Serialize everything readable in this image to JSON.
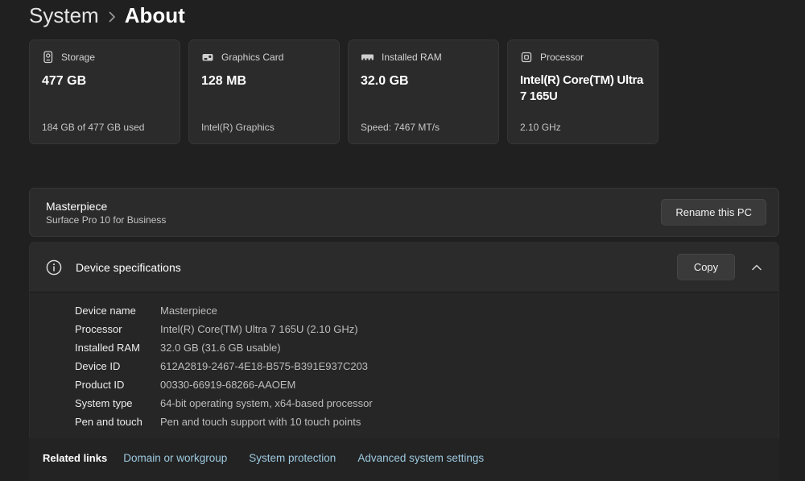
{
  "breadcrumb": {
    "root": "System",
    "current": "About",
    "separator_icon": "chevron-right-icon"
  },
  "cards": [
    {
      "icon": "storage-icon",
      "label": "Storage",
      "value": "477 GB",
      "caption": "184 GB of 477 GB used"
    },
    {
      "icon": "gpu-icon",
      "label": "Graphics Card",
      "value": "128 MB",
      "caption": "Intel(R) Graphics"
    },
    {
      "icon": "ram-icon",
      "label": "Installed RAM",
      "value": "32.0 GB",
      "caption": "Speed: 7467 MT/s"
    },
    {
      "icon": "processor-icon",
      "label": "Processor",
      "value": "Intel(R) Core(TM) Ultra 7 165U",
      "caption": "2.10 GHz"
    }
  ],
  "device_panel": {
    "name": "Masterpiece",
    "model": "Surface Pro 10 for Business",
    "rename_button": "Rename this PC"
  },
  "specifications": {
    "icon": "info-icon",
    "title": "Device specifications",
    "copy_button": "Copy",
    "state_icon": "chevron-up-icon",
    "rows": [
      {
        "label": "Device name",
        "value": "Masterpiece"
      },
      {
        "label": "Processor",
        "value": "Intel(R) Core(TM) Ultra 7 165U (2.10 GHz)"
      },
      {
        "label": "Installed RAM",
        "value": "32.0 GB (31.6 GB usable)"
      },
      {
        "label": "Device ID",
        "value": "612A2819-2467-4E18-B575-B391E937C203"
      },
      {
        "label": "Product ID",
        "value": "00330-66919-68266-AAOEM"
      },
      {
        "label": "System type",
        "value": "64-bit operating system, x64-based processor"
      },
      {
        "label": "Pen and touch",
        "value": "Pen and touch support with 10 touch points"
      }
    ]
  },
  "related": {
    "label": "Related links",
    "links": [
      "Domain or workgroup",
      "System protection",
      "Advanced system settings"
    ]
  },
  "colors": {
    "page_bg": "#202020",
    "card_bg": "#2b2b2b",
    "button_bg": "#3a3a3a",
    "link": "#9dc9df",
    "text_primary": "#ffffff",
    "text_secondary": "#c6c6c6"
  }
}
